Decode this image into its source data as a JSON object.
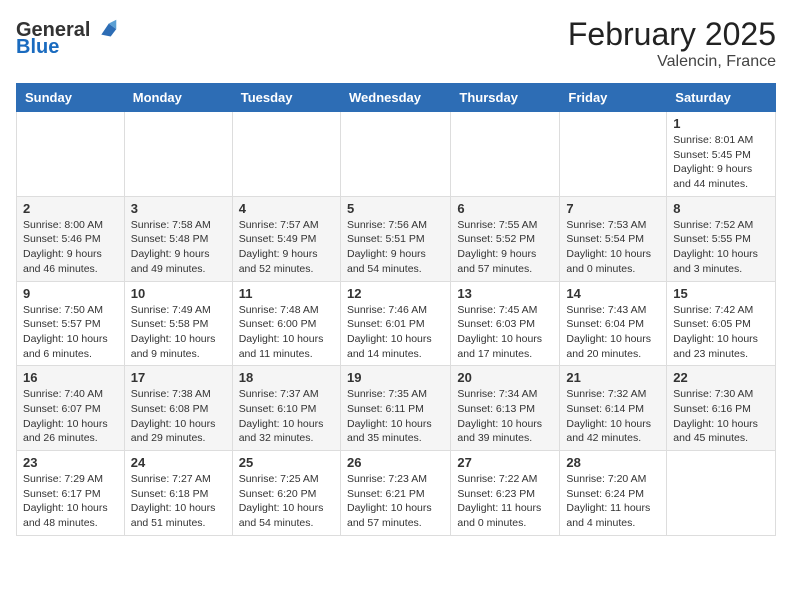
{
  "logo": {
    "text_general": "General",
    "text_blue": "Blue"
  },
  "header": {
    "month_year": "February 2025",
    "location": "Valencin, France"
  },
  "weekdays": [
    "Sunday",
    "Monday",
    "Tuesday",
    "Wednesday",
    "Thursday",
    "Friday",
    "Saturday"
  ],
  "weeks": [
    [
      {
        "day": "",
        "info": ""
      },
      {
        "day": "",
        "info": ""
      },
      {
        "day": "",
        "info": ""
      },
      {
        "day": "",
        "info": ""
      },
      {
        "day": "",
        "info": ""
      },
      {
        "day": "",
        "info": ""
      },
      {
        "day": "1",
        "info": "Sunrise: 8:01 AM\nSunset: 5:45 PM\nDaylight: 9 hours and 44 minutes."
      }
    ],
    [
      {
        "day": "2",
        "info": "Sunrise: 8:00 AM\nSunset: 5:46 PM\nDaylight: 9 hours and 46 minutes."
      },
      {
        "day": "3",
        "info": "Sunrise: 7:58 AM\nSunset: 5:48 PM\nDaylight: 9 hours and 49 minutes."
      },
      {
        "day": "4",
        "info": "Sunrise: 7:57 AM\nSunset: 5:49 PM\nDaylight: 9 hours and 52 minutes."
      },
      {
        "day": "5",
        "info": "Sunrise: 7:56 AM\nSunset: 5:51 PM\nDaylight: 9 hours and 54 minutes."
      },
      {
        "day": "6",
        "info": "Sunrise: 7:55 AM\nSunset: 5:52 PM\nDaylight: 9 hours and 57 minutes."
      },
      {
        "day": "7",
        "info": "Sunrise: 7:53 AM\nSunset: 5:54 PM\nDaylight: 10 hours and 0 minutes."
      },
      {
        "day": "8",
        "info": "Sunrise: 7:52 AM\nSunset: 5:55 PM\nDaylight: 10 hours and 3 minutes."
      }
    ],
    [
      {
        "day": "9",
        "info": "Sunrise: 7:50 AM\nSunset: 5:57 PM\nDaylight: 10 hours and 6 minutes."
      },
      {
        "day": "10",
        "info": "Sunrise: 7:49 AM\nSunset: 5:58 PM\nDaylight: 10 hours and 9 minutes."
      },
      {
        "day": "11",
        "info": "Sunrise: 7:48 AM\nSunset: 6:00 PM\nDaylight: 10 hours and 11 minutes."
      },
      {
        "day": "12",
        "info": "Sunrise: 7:46 AM\nSunset: 6:01 PM\nDaylight: 10 hours and 14 minutes."
      },
      {
        "day": "13",
        "info": "Sunrise: 7:45 AM\nSunset: 6:03 PM\nDaylight: 10 hours and 17 minutes."
      },
      {
        "day": "14",
        "info": "Sunrise: 7:43 AM\nSunset: 6:04 PM\nDaylight: 10 hours and 20 minutes."
      },
      {
        "day": "15",
        "info": "Sunrise: 7:42 AM\nSunset: 6:05 PM\nDaylight: 10 hours and 23 minutes."
      }
    ],
    [
      {
        "day": "16",
        "info": "Sunrise: 7:40 AM\nSunset: 6:07 PM\nDaylight: 10 hours and 26 minutes."
      },
      {
        "day": "17",
        "info": "Sunrise: 7:38 AM\nSunset: 6:08 PM\nDaylight: 10 hours and 29 minutes."
      },
      {
        "day": "18",
        "info": "Sunrise: 7:37 AM\nSunset: 6:10 PM\nDaylight: 10 hours and 32 minutes."
      },
      {
        "day": "19",
        "info": "Sunrise: 7:35 AM\nSunset: 6:11 PM\nDaylight: 10 hours and 35 minutes."
      },
      {
        "day": "20",
        "info": "Sunrise: 7:34 AM\nSunset: 6:13 PM\nDaylight: 10 hours and 39 minutes."
      },
      {
        "day": "21",
        "info": "Sunrise: 7:32 AM\nSunset: 6:14 PM\nDaylight: 10 hours and 42 minutes."
      },
      {
        "day": "22",
        "info": "Sunrise: 7:30 AM\nSunset: 6:16 PM\nDaylight: 10 hours and 45 minutes."
      }
    ],
    [
      {
        "day": "23",
        "info": "Sunrise: 7:29 AM\nSunset: 6:17 PM\nDaylight: 10 hours and 48 minutes."
      },
      {
        "day": "24",
        "info": "Sunrise: 7:27 AM\nSunset: 6:18 PM\nDaylight: 10 hours and 51 minutes."
      },
      {
        "day": "25",
        "info": "Sunrise: 7:25 AM\nSunset: 6:20 PM\nDaylight: 10 hours and 54 minutes."
      },
      {
        "day": "26",
        "info": "Sunrise: 7:23 AM\nSunset: 6:21 PM\nDaylight: 10 hours and 57 minutes."
      },
      {
        "day": "27",
        "info": "Sunrise: 7:22 AM\nSunset: 6:23 PM\nDaylight: 11 hours and 0 minutes."
      },
      {
        "day": "28",
        "info": "Sunrise: 7:20 AM\nSunset: 6:24 PM\nDaylight: 11 hours and 4 minutes."
      },
      {
        "day": "",
        "info": ""
      }
    ]
  ]
}
